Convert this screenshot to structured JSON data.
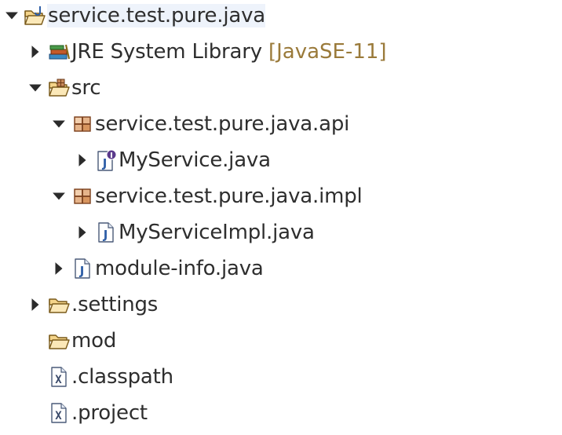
{
  "tree": {
    "project": {
      "label": "service.test.pure.java",
      "icon": "java-project-folder-icon"
    },
    "jre": {
      "label": "JRE System Library",
      "decoration": "[JavaSE-11]",
      "icon": "library-books-icon"
    },
    "src": {
      "label": "src",
      "icon": "source-folder-icon"
    },
    "api_package": {
      "label": "service.test.pure.java.api",
      "icon": "package-icon"
    },
    "myservice": {
      "label": "MyService.java",
      "icon": "java-interface-file-icon"
    },
    "impl_package": {
      "label": "service.test.pure.java.impl",
      "icon": "package-icon"
    },
    "myserviceimpl": {
      "label": "MyServiceImpl.java",
      "icon": "java-file-icon"
    },
    "module_info": {
      "label": "module-info.java",
      "icon": "java-file-icon"
    },
    "settings": {
      "label": ".settings",
      "icon": "folder-icon"
    },
    "mod": {
      "label": "mod",
      "icon": "folder-icon"
    },
    "classpath": {
      "label": ".classpath",
      "icon": "xml-file-icon"
    },
    "project_file": {
      "label": ".project",
      "icon": "xml-file-icon"
    }
  },
  "colors": {
    "text": "#2e2e2e",
    "decoration": "#9a7a3a",
    "folder": "#e8b45a",
    "java_blue": "#2f5fa7",
    "package": "#a85a2a",
    "interface_badge": "#5b3a8c"
  }
}
